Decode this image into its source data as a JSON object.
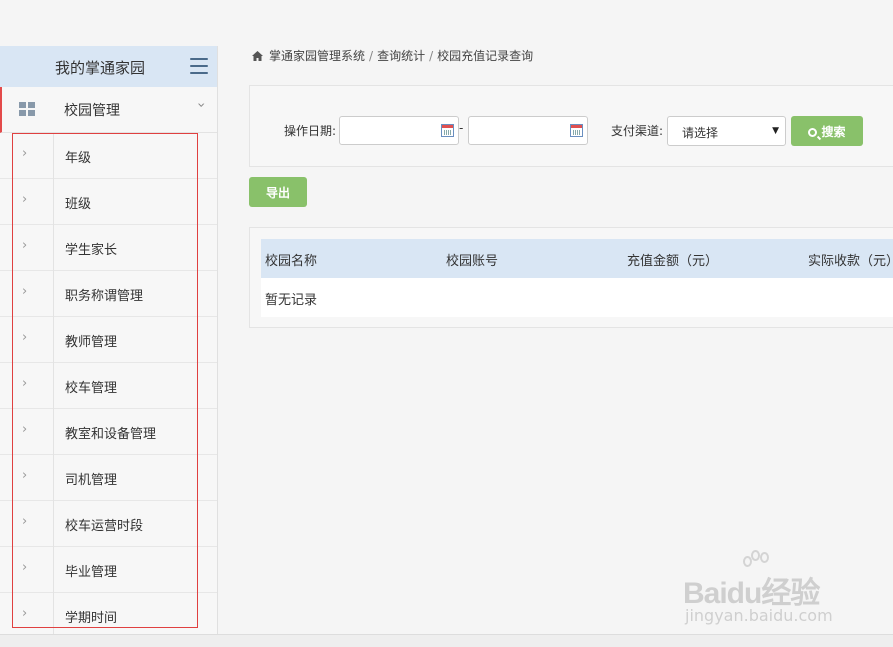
{
  "sidebar": {
    "title": "我的掌通家园",
    "section": "校园管理",
    "items": [
      {
        "label": "年级"
      },
      {
        "label": "班级"
      },
      {
        "label": "学生家长"
      },
      {
        "label": "职务称谓管理"
      },
      {
        "label": "教师管理"
      },
      {
        "label": "校车管理"
      },
      {
        "label": "教室和设备管理"
      },
      {
        "label": "司机管理"
      },
      {
        "label": "校车运营时段"
      },
      {
        "label": "毕业管理"
      },
      {
        "label": "学期时间"
      }
    ]
  },
  "breadcrumb": {
    "items": [
      "掌通家园管理系统",
      "查询统计",
      "校园充值记录查询"
    ]
  },
  "filter": {
    "date_label": "操作日期:",
    "date_sep": "-",
    "start_date": "",
    "end_date": "",
    "channel_label": "支付渠道:",
    "channel_value": "请选择",
    "search_label": "搜索"
  },
  "export_label": "导出",
  "table": {
    "columns": [
      "校园名称",
      "校园账号",
      "充值金额（元）",
      "实际收款（元）"
    ],
    "empty_text": "暂无记录"
  },
  "watermark": {
    "brand": "Baidu经验",
    "url": "jingyan.baidu.com"
  },
  "colors": {
    "accent_green": "#89c16a",
    "header_blue": "#d9e6f4",
    "selection_red": "#e04040"
  }
}
